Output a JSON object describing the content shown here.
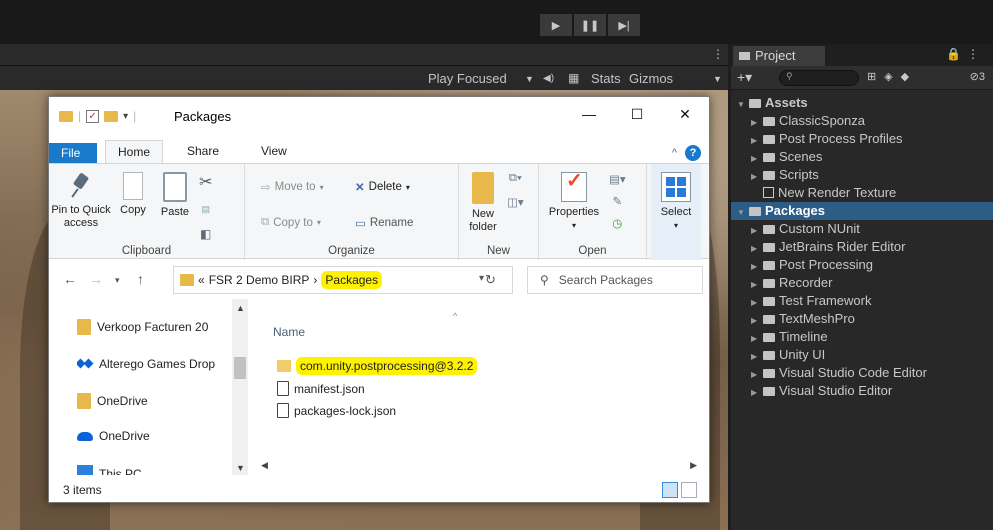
{
  "unity": {
    "play_controls": [
      "▶",
      "❚❚",
      "▶|"
    ],
    "gamebar": {
      "play_focused": "Play Focused",
      "stats": "Stats",
      "gizmos": "Gizmos"
    },
    "project_panel": {
      "tab_label": "Project",
      "badge_count": "3",
      "tree": [
        {
          "label": "Assets",
          "depth": 0,
          "expanded": true,
          "bold": true,
          "selected": false
        },
        {
          "label": "ClassicSponza",
          "depth": 1,
          "selected": false
        },
        {
          "label": "Post Process Profiles",
          "depth": 1,
          "selected": false
        },
        {
          "label": "Scenes",
          "depth": 1,
          "selected": false
        },
        {
          "label": "Scripts",
          "depth": 1,
          "selected": false
        },
        {
          "label": "New Render Texture",
          "depth": 1,
          "leaf": true,
          "selected": false
        },
        {
          "label": "Packages",
          "depth": 0,
          "expanded": true,
          "bold": true,
          "selected": true
        },
        {
          "label": "Custom NUnit",
          "depth": 1,
          "selected": false
        },
        {
          "label": "JetBrains Rider Editor",
          "depth": 1,
          "selected": false
        },
        {
          "label": "Post Processing",
          "depth": 1,
          "selected": false
        },
        {
          "label": "Recorder",
          "depth": 1,
          "selected": false
        },
        {
          "label": "Test Framework",
          "depth": 1,
          "selected": false
        },
        {
          "label": "TextMeshPro",
          "depth": 1,
          "selected": false
        },
        {
          "label": "Timeline",
          "depth": 1,
          "selected": false
        },
        {
          "label": "Unity UI",
          "depth": 1,
          "selected": false
        },
        {
          "label": "Visual Studio Code Editor",
          "depth": 1,
          "selected": false
        },
        {
          "label": "Visual Studio Editor",
          "depth": 1,
          "selected": false
        }
      ]
    }
  },
  "explorer": {
    "window_title": "Packages",
    "window_buttons": {
      "minimize": "—",
      "maximize": "☐",
      "close": "✕"
    },
    "ribbon_tabs": {
      "file": "File",
      "home": "Home",
      "share": "Share",
      "view": "View"
    },
    "clipboard": {
      "pin": "Pin to Quick access",
      "copy": "Copy",
      "paste": "Paste",
      "label": "Clipboard"
    },
    "organize": {
      "move_to": "Move to",
      "copy_to": "Copy to",
      "delete": "Delete",
      "rename": "Rename",
      "label": "Organize"
    },
    "new_group": {
      "new_folder": "New folder",
      "label": "New"
    },
    "open_group": {
      "properties": "Properties",
      "label": "Open"
    },
    "select_group": {
      "select": "Select"
    },
    "address": {
      "prefix": "«",
      "parent": "FSR 2 Demo BIRP",
      "separator": "›",
      "current": "Packages"
    },
    "search_placeholder": "Search Packages",
    "nav_items": [
      {
        "label": "Verkoop Facturen 20",
        "icon": "folder-icon"
      },
      {
        "label": "Alterego Games Drop",
        "icon": "dropbox-icon"
      },
      {
        "label": "OneDrive",
        "icon": "folder-icon"
      },
      {
        "label": "OneDrive",
        "icon": "onedrive-cloud-icon"
      },
      {
        "label": "This PC",
        "icon": "pc-icon"
      }
    ],
    "column_name": "Name",
    "files": [
      {
        "name": "com.unity.postprocessing@3.2.2",
        "type": "folder",
        "highlighted": true
      },
      {
        "name": "manifest.json",
        "type": "file",
        "highlighted": false
      },
      {
        "name": "packages-lock.json",
        "type": "file",
        "highlighted": false
      }
    ],
    "status": "3 items",
    "colors": {
      "accent": "#1979ca",
      "highlight": "#fff200",
      "folder": "#e8b84a"
    }
  }
}
